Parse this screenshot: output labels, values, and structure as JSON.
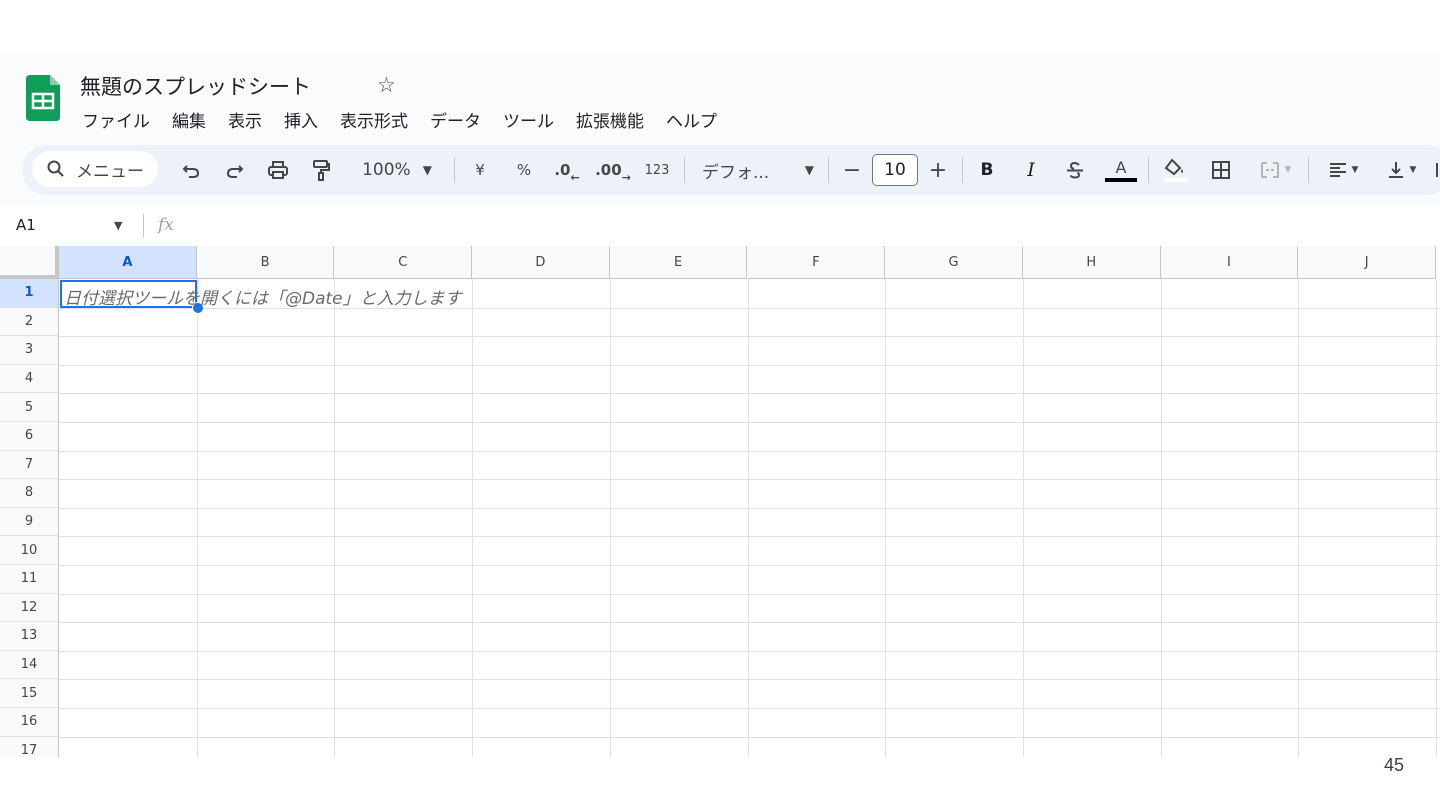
{
  "app": {
    "title": "無題のスプレッドシート",
    "star_icon": "star-outline-icon",
    "logo_icon": "google-sheets-logo",
    "brand_color": "#0f9d58"
  },
  "menubar": [
    "ファイル",
    "編集",
    "表示",
    "挿入",
    "表示形式",
    "データ",
    "ツール",
    "拡張機能",
    "ヘルプ"
  ],
  "toolbar": {
    "search_label": "メニュー",
    "zoom": "100%",
    "currency": "¥",
    "percent": "%",
    "decimal_decrease": ".0",
    "decimal_increase": ".00",
    "number_format": "123",
    "font_name": "デフォ...",
    "font_size": "10",
    "minus": "−",
    "plus": "+",
    "bold": "B",
    "italic": "I",
    "text_color": "A",
    "text_color_value": "#000000",
    "fill_color_value": "#ffffff"
  },
  "formula_bar": {
    "name_box": "A1",
    "fx_label": "fx",
    "value": ""
  },
  "grid": {
    "columns": [
      "A",
      "B",
      "C",
      "D",
      "E",
      "F",
      "G",
      "H",
      "I",
      "J"
    ],
    "rows": [
      "1",
      "2",
      "3",
      "4",
      "5",
      "6",
      "7",
      "8",
      "9",
      "10",
      "11",
      "12",
      "13",
      "14",
      "15",
      "16",
      "17"
    ],
    "selected_cell": "A1",
    "cell_hint": "日付選択ツールを開くには「@Date」と入力します",
    "selection_color": "#1a73e8"
  },
  "page_number": "45"
}
